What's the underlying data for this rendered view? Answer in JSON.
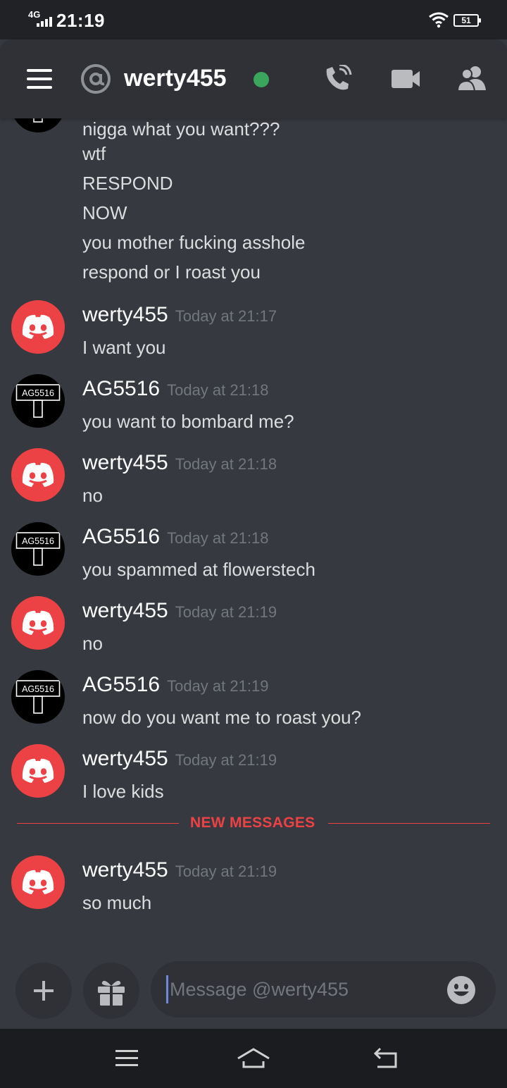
{
  "status_bar": {
    "network": "4G",
    "time": "21:19",
    "battery": "51"
  },
  "header": {
    "channel_prefix_icon": "at-icon",
    "title": "werty455",
    "status_color": "#3ba55d",
    "icons": [
      "hamburger-menu-icon",
      "call-icon",
      "video-camera-icon",
      "members-icon"
    ]
  },
  "colors": {
    "background": "#36393f",
    "header": "#2f3136",
    "accent_red": "#ed4245",
    "timestamp": "#72767d",
    "online": "#3ba55d"
  },
  "continued_lines": [
    "nigga what you want???",
    "wtf",
    "RESPOND",
    "NOW",
    "you mother fucking asshole",
    "respond or I roast you"
  ],
  "messages": [
    {
      "author": "werty455",
      "timestamp": "Today at 21:17",
      "text": "I want you",
      "avatar": "discord-logo-icon"
    },
    {
      "author": "AG5516",
      "timestamp": "Today at 21:18",
      "text": "you want to bombard me?",
      "avatar": "AG5516"
    },
    {
      "author": "werty455",
      "timestamp": "Today at 21:18",
      "text": "no",
      "avatar": "discord-logo-icon"
    },
    {
      "author": "AG5516",
      "timestamp": "Today at 21:18",
      "text": "you spammed at flowerstech",
      "avatar": "AG5516"
    },
    {
      "author": "werty455",
      "timestamp": "Today at 21:19",
      "text": "no",
      "avatar": "discord-logo-icon"
    },
    {
      "author": "AG5516",
      "timestamp": "Today at 21:19",
      "text": "now do you want me to roast you?",
      "avatar": "AG5516"
    },
    {
      "author": "werty455",
      "timestamp": "Today at 21:19",
      "text": "I love kids",
      "avatar": "discord-logo-icon"
    }
  ],
  "new_messages_label": "NEW MESSAGES",
  "new_messages": [
    {
      "author": "werty455",
      "timestamp": "Today at 21:19",
      "text": "so much",
      "avatar": "discord-logo-icon"
    }
  ],
  "composer": {
    "placeholder": "Message @werty455",
    "value": "",
    "icons": [
      "plus-icon",
      "gift-icon",
      "emoji-icon"
    ]
  },
  "nav_bar": {
    "icons": [
      "recents-icon",
      "home-icon",
      "back-icon"
    ]
  }
}
